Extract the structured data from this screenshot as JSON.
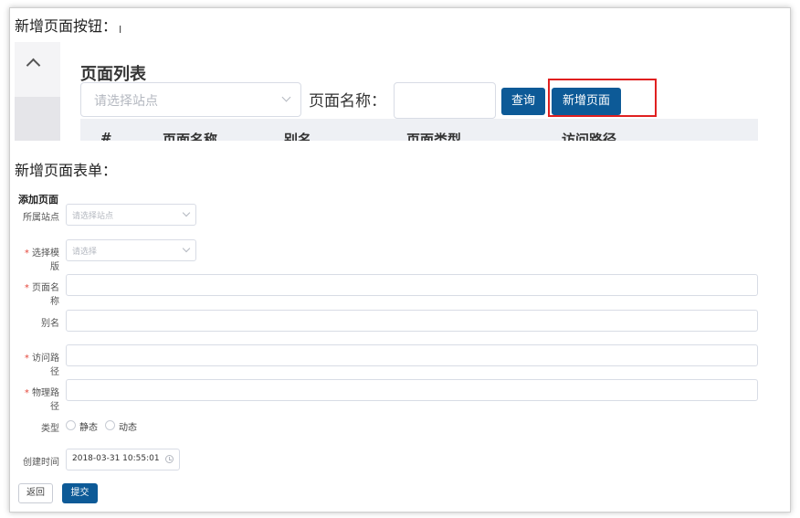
{
  "section_add_button": {
    "heading": "新增页面按钮："
  },
  "page_list": {
    "title": "页面列表",
    "site_select_placeholder": "请选择站点",
    "name_label": "页面名称：",
    "search_label": "查询",
    "add_page_label": "新增页面",
    "columns": [
      "#",
      "页面名称",
      "别名",
      "页面类型",
      "访问路径"
    ]
  },
  "section_add_form": {
    "heading": "新增页面表单："
  },
  "form": {
    "title": "添加页面",
    "site_label": "所属站点",
    "site_placeholder": "请选择站点",
    "template_label": "选择模版",
    "template_placeholder": "请选择",
    "page_name_label": "页面名称",
    "alias_label": "别名",
    "access_path_label": "访问路径",
    "physical_path_label": "物理路径",
    "type_label": "类型",
    "type_options": [
      "静态",
      "动态"
    ],
    "created_label": "创建时间",
    "created_value": "2018-03-31 10:55:01",
    "back_label": "返回",
    "submit_label": "提交",
    "required_mark": "*"
  },
  "colors": {
    "primary": "#0d5a97",
    "highlight": "#e02020",
    "required": "#e5473b"
  },
  "icons": [
    "chevron-up-icon",
    "chevron-down-icon",
    "clock-icon",
    "text-cursor-icon"
  ]
}
